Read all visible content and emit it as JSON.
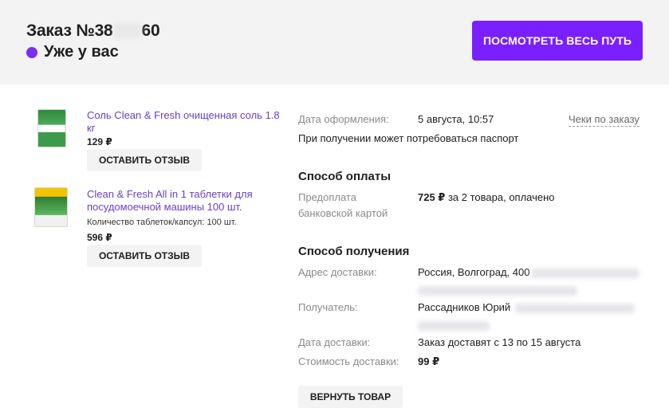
{
  "header": {
    "order_prefix": "Заказ №38",
    "order_suffix": "60",
    "status": "Уже у вас",
    "track_button": "ПОСМОТРЕТЬ ВЕСЬ ПУТЬ",
    "status_color": "#7b2df2",
    "accent_color": "#7a1fff"
  },
  "items": [
    {
      "title": "Соль Clean & Fresh очищенная соль 1.8 кг",
      "price": "129 ₽",
      "review_button": "ОСТАВИТЬ ОТЗЫВ"
    },
    {
      "title": "Clean & Fresh All in 1 таблетки для посудомоечной машины 100 шт.",
      "attribute": "Количество таблеток/капсул: 100 шт.",
      "price": "596 ₽",
      "review_button": "ОСТАВИТЬ ОТЗЫВ"
    }
  ],
  "details": {
    "order_date_label": "Дата оформления:",
    "order_date_value": "5 августа, 10:57",
    "receipts_link": "Чеки по заказу",
    "passport_note": "При получении может потребоваться паспорт",
    "payment_title": "Способ оплаты",
    "payment_label": "Предоплата банковской картой",
    "payment_amount": "725 ₽",
    "payment_desc": " за 2 товара, оплачено",
    "delivery_title": "Способ получения",
    "address_label": "Адрес доставки:",
    "address_value": "Россия, Волгоград, 400",
    "recipient_label": "Получатель:",
    "recipient_value": "Рассадников Юрий",
    "delivery_date_label": "Дата доставки:",
    "delivery_date_value": "Заказ доставят с 13 по 15 августа",
    "delivery_cost_label": "Стоимость доставки:",
    "delivery_cost_value": "99 ₽",
    "return_button": "ВЕРНУТЬ ТОВАР"
  }
}
